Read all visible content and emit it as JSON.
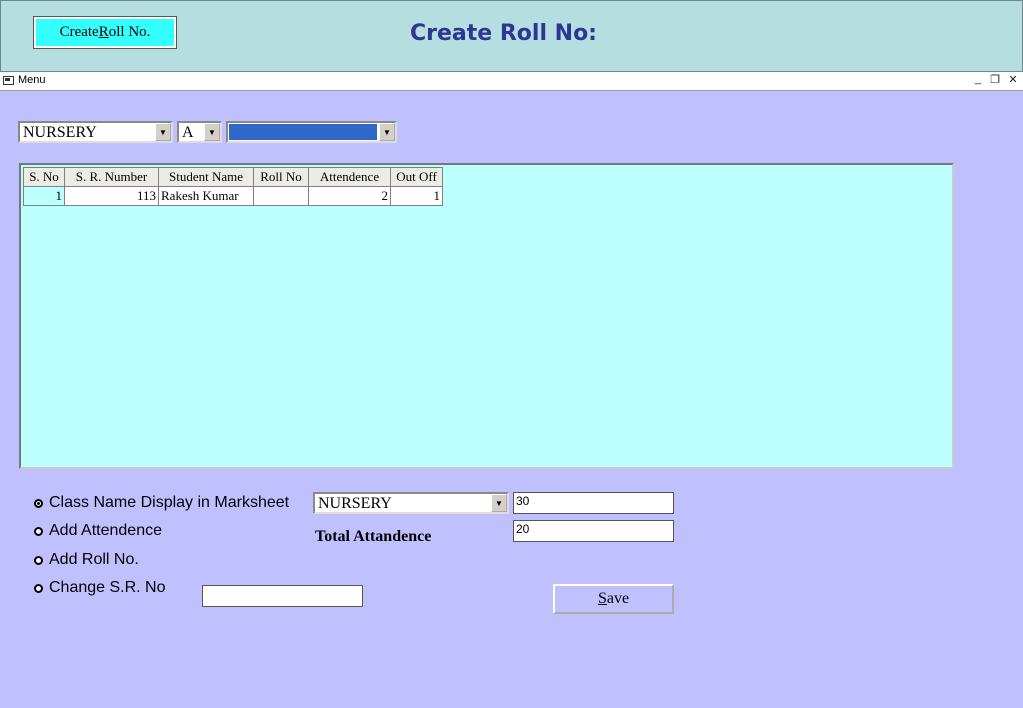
{
  "header": {
    "button_label_pre": "Create ",
    "button_label_key": "R",
    "button_label_post": "oll No.",
    "title": "Create Roll No:"
  },
  "menubar": {
    "menu_label": "Menu",
    "window_controls": [
      "_",
      "❐",
      "✕"
    ]
  },
  "filters": {
    "class_value": "NURSERY",
    "section_value": "A",
    "third_value": ""
  },
  "table": {
    "columns": [
      "S. No",
      "S. R. Number",
      "Student Name",
      "Roll No",
      "Attendence",
      "Out Off"
    ],
    "rows": [
      [
        "1",
        "113",
        "Rakesh Kumar",
        "",
        "2",
        "1"
      ]
    ]
  },
  "options": {
    "items": [
      "Class Name Display in Marksheet",
      "Add Attendence",
      "Add Roll No.",
      "Change S.R. No"
    ],
    "selected_index": 0
  },
  "form": {
    "class_select_value": "NURSERY",
    "field1_value": "30",
    "field2_value": "20",
    "total_label": "Total Attandence",
    "change_sr_value": "",
    "save_pre": "",
    "save_key": "S",
    "save_post": "ave"
  },
  "colors": {
    "title_text": "#2a3793",
    "header_bg": "#b6dde0",
    "body_bg": "#c0c0ff",
    "grid_bg": "#bbffff",
    "button_cyan": "#33ffff",
    "selection_blue": "#3168c8"
  }
}
